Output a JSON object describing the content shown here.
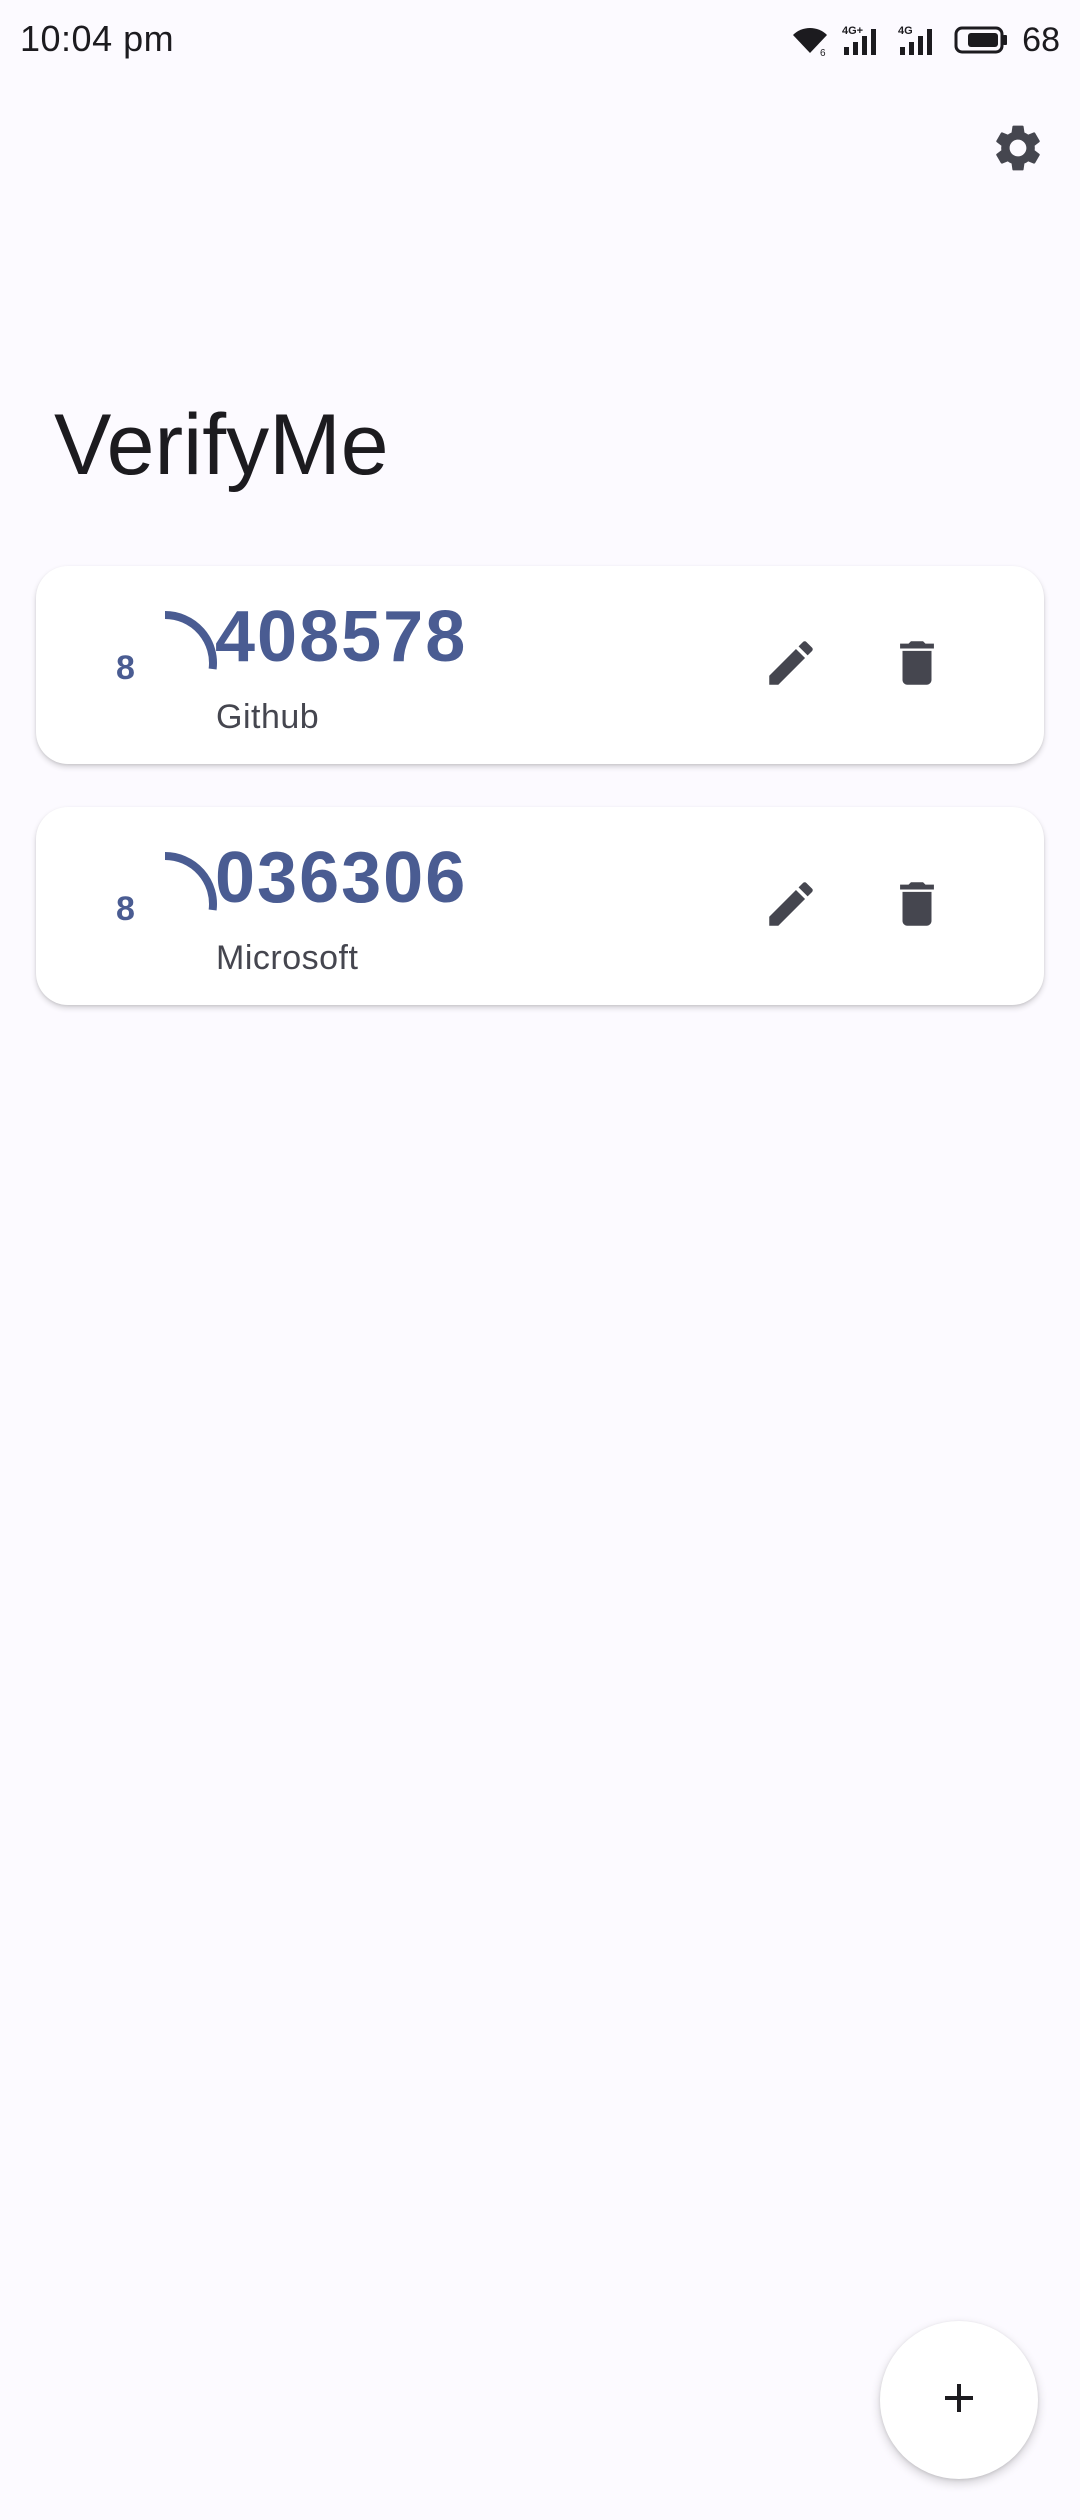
{
  "status_bar": {
    "time": "10:04 pm",
    "battery_percent": "68",
    "icons": [
      "wifi-icon",
      "signal-4g-plus-icon",
      "signal-4g-icon",
      "battery-icon"
    ]
  },
  "header": {
    "settings_icon": "gear-icon"
  },
  "app": {
    "title": "VerifyMe"
  },
  "accounts": [
    {
      "code": "408578",
      "name": "Github",
      "seconds_remaining": "8",
      "progress_fraction": 0.27
    },
    {
      "code": "036306",
      "name": "Microsoft",
      "seconds_remaining": "8",
      "progress_fraction": 0.27
    }
  ],
  "actions": {
    "edit_icon": "pencil-icon",
    "delete_icon": "trash-icon",
    "add_icon": "plus-icon"
  },
  "colors": {
    "accent": "#4a5c92",
    "background": "#fcfaff",
    "card": "#ffffff",
    "icon": "#45464f"
  }
}
